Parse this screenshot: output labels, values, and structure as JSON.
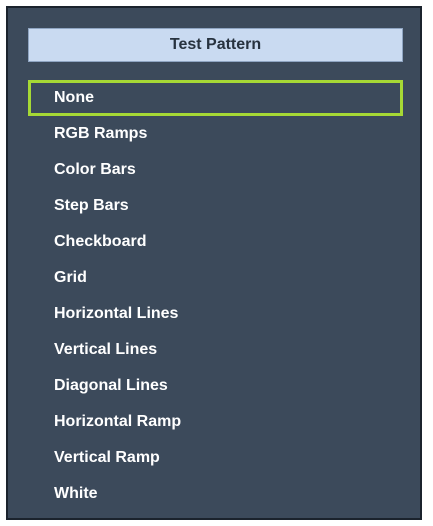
{
  "header": {
    "title": "Test Pattern"
  },
  "selected_index": 0,
  "items": [
    {
      "label": "None"
    },
    {
      "label": "RGB Ramps"
    },
    {
      "label": "Color Bars"
    },
    {
      "label": "Step Bars"
    },
    {
      "label": "Checkboard"
    },
    {
      "label": "Grid"
    },
    {
      "label": "Horizontal Lines"
    },
    {
      "label": "Vertical Lines"
    },
    {
      "label": "Diagonal Lines"
    },
    {
      "label": "Horizontal Ramp"
    },
    {
      "label": "Vertical Ramp"
    },
    {
      "label": "White"
    }
  ],
  "colors": {
    "panel_background": "#3c4a5b",
    "header_background": "#c9daf1",
    "selection_outline": "#a6d935",
    "item_text": "#ffffff"
  }
}
